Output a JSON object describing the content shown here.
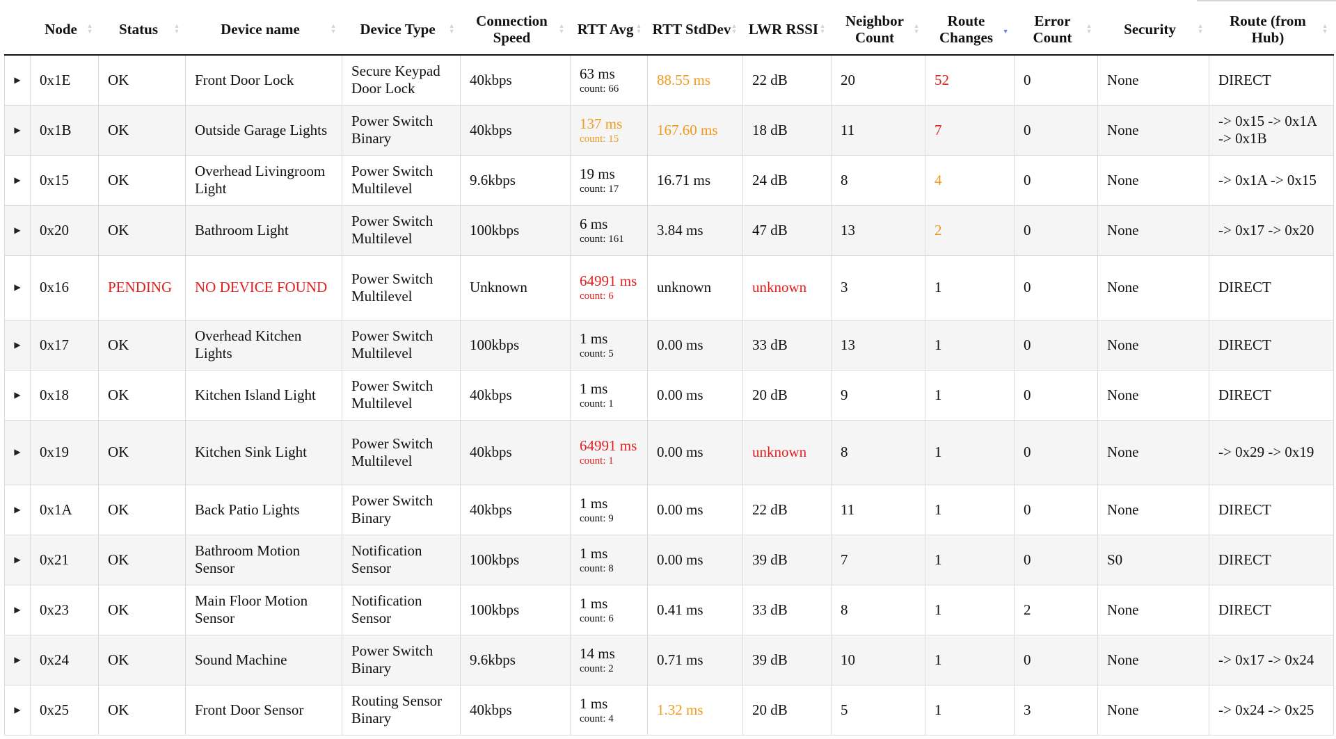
{
  "colors": {
    "error": "#e0201e",
    "warning": "#f09a1c",
    "sort_active": "#6a7fd8",
    "row_alt": "#f5f5f5",
    "border": "#dcdcdc"
  },
  "icons": {
    "expand": "▶",
    "sort_up": "▲",
    "sort_down": "▼"
  },
  "columns": [
    {
      "key": "node",
      "label": "Node",
      "sort": "none"
    },
    {
      "key": "status",
      "label": "Status",
      "sort": "none"
    },
    {
      "key": "device_name",
      "label": "Device name",
      "sort": "none"
    },
    {
      "key": "device_type",
      "label": "Device Type",
      "sort": "none"
    },
    {
      "key": "connection_speed",
      "label": "Connection Speed",
      "sort": "none"
    },
    {
      "key": "rtt_avg",
      "label": "RTT Avg",
      "sort": "none"
    },
    {
      "key": "rtt_stddev",
      "label": "RTT StdDev",
      "sort": "none"
    },
    {
      "key": "lwr_rssi",
      "label": "LWR RSSI",
      "sort": "none"
    },
    {
      "key": "neighbor_count",
      "label": "Neighbor Count",
      "sort": "none"
    },
    {
      "key": "route_changes",
      "label": "Route Changes",
      "sort": "desc"
    },
    {
      "key": "error_count",
      "label": "Error Count",
      "sort": "none"
    },
    {
      "key": "security",
      "label": "Security",
      "sort": "none"
    },
    {
      "key": "route",
      "label": "Route (from Hub)",
      "sort": "none"
    }
  ],
  "rows": [
    {
      "node": "0x1E",
      "status": "OK",
      "device_name": "Front Door Lock",
      "device_type": "Secure Keypad Door Lock",
      "connection_speed": "40kbps",
      "rtt_avg": "63 ms",
      "rtt_count": "count: 66",
      "rtt_avg_level": "normal",
      "rtt_stddev": "88.55 ms",
      "rtt_stddev_level": "warning",
      "lwr_rssi": "22 dB",
      "lwr_rssi_level": "normal",
      "neighbor_count": "20",
      "route_changes": "52",
      "route_changes_level": "error",
      "error_count": "0",
      "security": "None",
      "route": "DIRECT"
    },
    {
      "node": "0x1B",
      "status": "OK",
      "device_name": "Outside Garage Lights",
      "device_type": "Power Switch Binary",
      "connection_speed": "40kbps",
      "rtt_avg": "137 ms",
      "rtt_count": "count: 15",
      "rtt_avg_level": "warning",
      "rtt_stddev": "167.60 ms",
      "rtt_stddev_level": "warning",
      "lwr_rssi": "18 dB",
      "lwr_rssi_level": "normal",
      "neighbor_count": "11",
      "route_changes": "7",
      "route_changes_level": "error",
      "error_count": "0",
      "security": "None",
      "route": "-> 0x15 -> 0x1A -> 0x1B"
    },
    {
      "node": "0x15",
      "status": "OK",
      "device_name": "Overhead Livingroom Light",
      "device_type": "Power Switch Multilevel",
      "connection_speed": "9.6kbps",
      "rtt_avg": "19 ms",
      "rtt_count": "count: 17",
      "rtt_avg_level": "normal",
      "rtt_stddev": "16.71 ms",
      "rtt_stddev_level": "normal",
      "lwr_rssi": "24 dB",
      "lwr_rssi_level": "normal",
      "neighbor_count": "8",
      "route_changes": "4",
      "route_changes_level": "warning",
      "error_count": "0",
      "security": "None",
      "route": "-> 0x1A -> 0x15"
    },
    {
      "node": "0x20",
      "status": "OK",
      "device_name": "Bathroom Light",
      "device_type": "Power Switch Multilevel",
      "connection_speed": "100kbps",
      "rtt_avg": "6 ms",
      "rtt_count": "count: 161",
      "rtt_avg_level": "normal",
      "rtt_stddev": "3.84 ms",
      "rtt_stddev_level": "normal",
      "lwr_rssi": "47 dB",
      "lwr_rssi_level": "normal",
      "neighbor_count": "13",
      "route_changes": "2",
      "route_changes_level": "warning",
      "error_count": "0",
      "security": "None",
      "route": "-> 0x17 -> 0x20"
    },
    {
      "node": "0x16",
      "status": "PENDING",
      "status_level": "error",
      "device_name": "NO DEVICE FOUND",
      "device_name_level": "error",
      "device_type": "Power Switch Multilevel",
      "connection_speed": "Unknown",
      "rtt_avg": "64991 ms",
      "rtt_count": "count: 6",
      "rtt_avg_level": "error",
      "rtt_stddev": "unknown",
      "rtt_stddev_level": "normal",
      "lwr_rssi": "unknown",
      "lwr_rssi_level": "error",
      "neighbor_count": "3",
      "route_changes": "1",
      "route_changes_level": "normal",
      "error_count": "0",
      "security": "None",
      "route": "DIRECT",
      "tall": true
    },
    {
      "node": "0x17",
      "status": "OK",
      "device_name": "Overhead Kitchen Lights",
      "device_type": "Power Switch Multilevel",
      "connection_speed": "100kbps",
      "rtt_avg": "1 ms",
      "rtt_count": "count: 5",
      "rtt_avg_level": "normal",
      "rtt_stddev": "0.00 ms",
      "rtt_stddev_level": "normal",
      "lwr_rssi": "33 dB",
      "lwr_rssi_level": "normal",
      "neighbor_count": "13",
      "route_changes": "1",
      "route_changes_level": "normal",
      "error_count": "0",
      "security": "None",
      "route": "DIRECT"
    },
    {
      "node": "0x18",
      "status": "OK",
      "device_name": "Kitchen Island Light",
      "device_type": "Power Switch Multilevel",
      "connection_speed": "40kbps",
      "rtt_avg": "1 ms",
      "rtt_count": "count: 1",
      "rtt_avg_level": "normal",
      "rtt_stddev": "0.00 ms",
      "rtt_stddev_level": "normal",
      "lwr_rssi": "20 dB",
      "lwr_rssi_level": "normal",
      "neighbor_count": "9",
      "route_changes": "1",
      "route_changes_level": "normal",
      "error_count": "0",
      "security": "None",
      "route": "DIRECT"
    },
    {
      "node": "0x19",
      "status": "OK",
      "device_name": "Kitchen Sink Light",
      "device_type": "Power Switch Multilevel",
      "connection_speed": "40kbps",
      "rtt_avg": "64991 ms",
      "rtt_count": "count: 1",
      "rtt_avg_level": "error",
      "rtt_stddev": "0.00 ms",
      "rtt_stddev_level": "normal",
      "lwr_rssi": "unknown",
      "lwr_rssi_level": "error",
      "neighbor_count": "8",
      "route_changes": "1",
      "route_changes_level": "normal",
      "error_count": "0",
      "security": "None",
      "route": "-> 0x29 -> 0x19",
      "tall": true
    },
    {
      "node": "0x1A",
      "status": "OK",
      "device_name": "Back Patio Lights",
      "device_type": "Power Switch Binary",
      "connection_speed": "40kbps",
      "rtt_avg": "1 ms",
      "rtt_count": "count: 9",
      "rtt_avg_level": "normal",
      "rtt_stddev": "0.00 ms",
      "rtt_stddev_level": "normal",
      "lwr_rssi": "22 dB",
      "lwr_rssi_level": "normal",
      "neighbor_count": "11",
      "route_changes": "1",
      "route_changes_level": "normal",
      "error_count": "0",
      "security": "None",
      "route": "DIRECT"
    },
    {
      "node": "0x21",
      "status": "OK",
      "device_name": "Bathroom Motion Sensor",
      "device_type": "Notification Sensor",
      "connection_speed": "100kbps",
      "rtt_avg": "1 ms",
      "rtt_count": "count: 8",
      "rtt_avg_level": "normal",
      "rtt_stddev": "0.00 ms",
      "rtt_stddev_level": "normal",
      "lwr_rssi": "39 dB",
      "lwr_rssi_level": "normal",
      "neighbor_count": "7",
      "route_changes": "1",
      "route_changes_level": "normal",
      "error_count": "0",
      "security": "S0",
      "route": "DIRECT"
    },
    {
      "node": "0x23",
      "status": "OK",
      "device_name": "Main Floor Motion Sensor",
      "device_type": "Notification Sensor",
      "connection_speed": "100kbps",
      "rtt_avg": "1 ms",
      "rtt_count": "count: 6",
      "rtt_avg_level": "normal",
      "rtt_stddev": "0.41 ms",
      "rtt_stddev_level": "normal",
      "lwr_rssi": "33 dB",
      "lwr_rssi_level": "normal",
      "neighbor_count": "8",
      "route_changes": "1",
      "route_changes_level": "normal",
      "error_count": "2",
      "security": "None",
      "route": "DIRECT"
    },
    {
      "node": "0x24",
      "status": "OK",
      "device_name": "Sound Machine",
      "device_type": "Power Switch Binary",
      "connection_speed": "9.6kbps",
      "rtt_avg": "14 ms",
      "rtt_count": "count: 2",
      "rtt_avg_level": "normal",
      "rtt_stddev": "0.71 ms",
      "rtt_stddev_level": "normal",
      "lwr_rssi": "39 dB",
      "lwr_rssi_level": "normal",
      "neighbor_count": "10",
      "route_changes": "1",
      "route_changes_level": "normal",
      "error_count": "0",
      "security": "None",
      "route": "-> 0x17 -> 0x24"
    },
    {
      "node": "0x25",
      "status": "OK",
      "device_name": "Front Door Sensor",
      "device_type": "Routing Sensor Binary",
      "connection_speed": "40kbps",
      "rtt_avg": "1 ms",
      "rtt_count": "count: 4",
      "rtt_avg_level": "normal",
      "rtt_stddev": "1.32 ms",
      "rtt_stddev_level": "warning",
      "lwr_rssi": "20 dB",
      "lwr_rssi_level": "normal",
      "neighbor_count": "5",
      "route_changes": "1",
      "route_changes_level": "normal",
      "error_count": "3",
      "security": "None",
      "route": "-> 0x24 -> 0x25"
    }
  ]
}
